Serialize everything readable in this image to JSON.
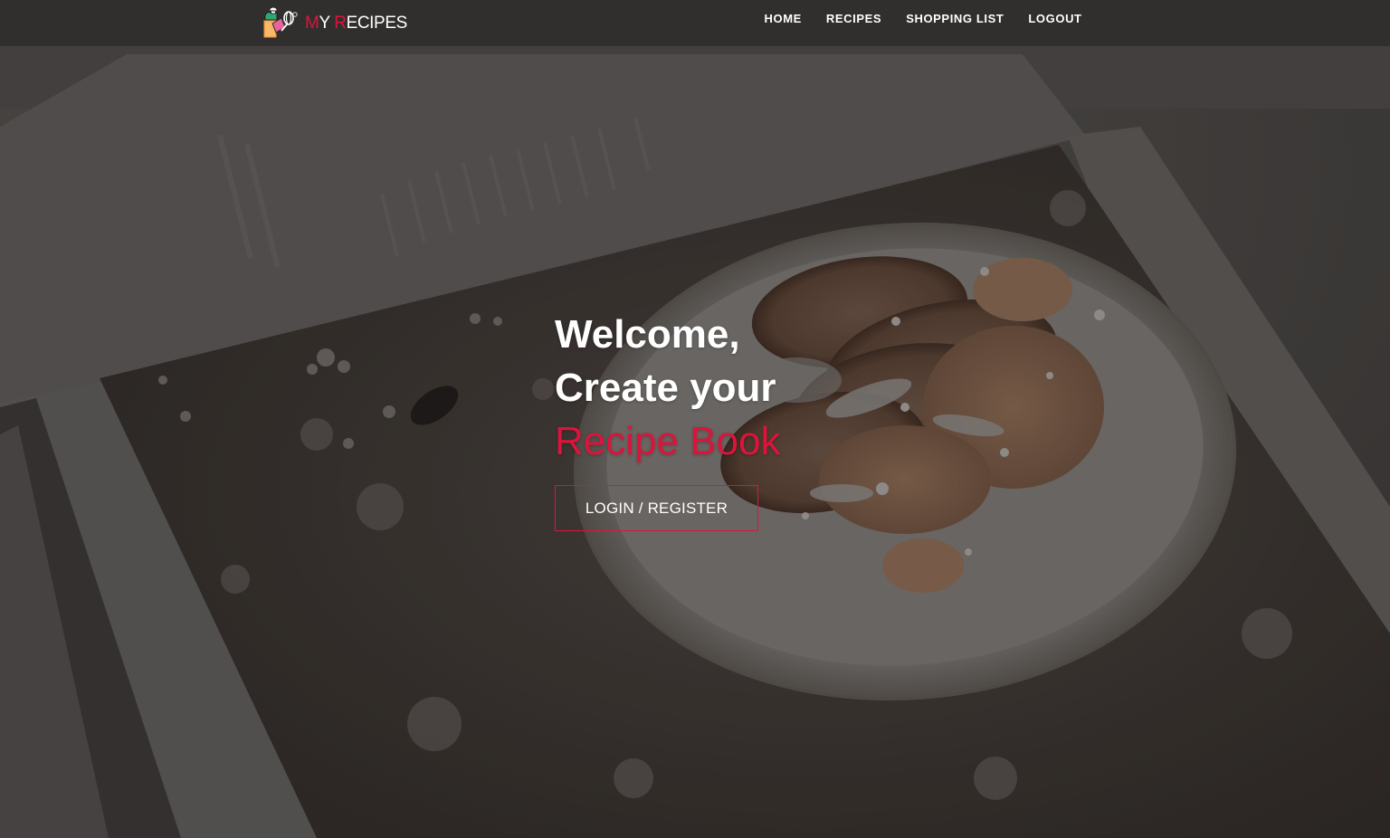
{
  "brand": {
    "text_first": "M",
    "text_second": "Y ",
    "text_third": "R",
    "text_fourth": "ECIPES",
    "logo_icon": "recipe-book-chef-logo",
    "accent_color": "#dc143c"
  },
  "nav": {
    "items": [
      {
        "label": "HOME"
      },
      {
        "label": "RECIPES"
      },
      {
        "label": "SHOPPING LIST"
      },
      {
        "label": "LOGOUT"
      }
    ]
  },
  "hero": {
    "line1": "Welcome,",
    "line2": "Create your",
    "line3": "Recipe Book",
    "cta_label": "LOGIN / REGISTER"
  },
  "colors": {
    "accent": "#dc143c",
    "text": "#ffffff",
    "navbar": "#302e2c"
  }
}
